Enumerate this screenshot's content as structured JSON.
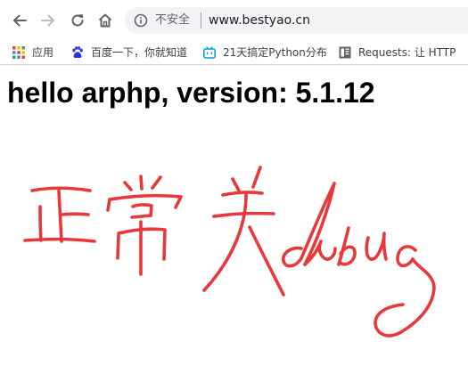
{
  "browser": {
    "nav": {
      "back_icon": "arrow-left-icon",
      "forward_icon": "arrow-right-icon",
      "reload_icon": "reload-icon",
      "home_icon": "home-icon"
    },
    "omnibox": {
      "info_icon": "info-circle-icon",
      "security_label": "不安全",
      "url": "www.bestyao.cn"
    },
    "bookmarks": [
      {
        "label": "应用",
        "icon": "apps-grid-icon"
      },
      {
        "label": "百度一下，你就知道",
        "icon": "baidu-paw-icon"
      },
      {
        "label": "21天搞定Python分布",
        "icon": "bilibili-tv-icon"
      },
      {
        "label": "Requests: 让 HTTP",
        "icon": "book-icon"
      }
    ]
  },
  "page": {
    "heading": "hello arphp, version: 5.1.12",
    "drawing_color": "#e8383a"
  }
}
